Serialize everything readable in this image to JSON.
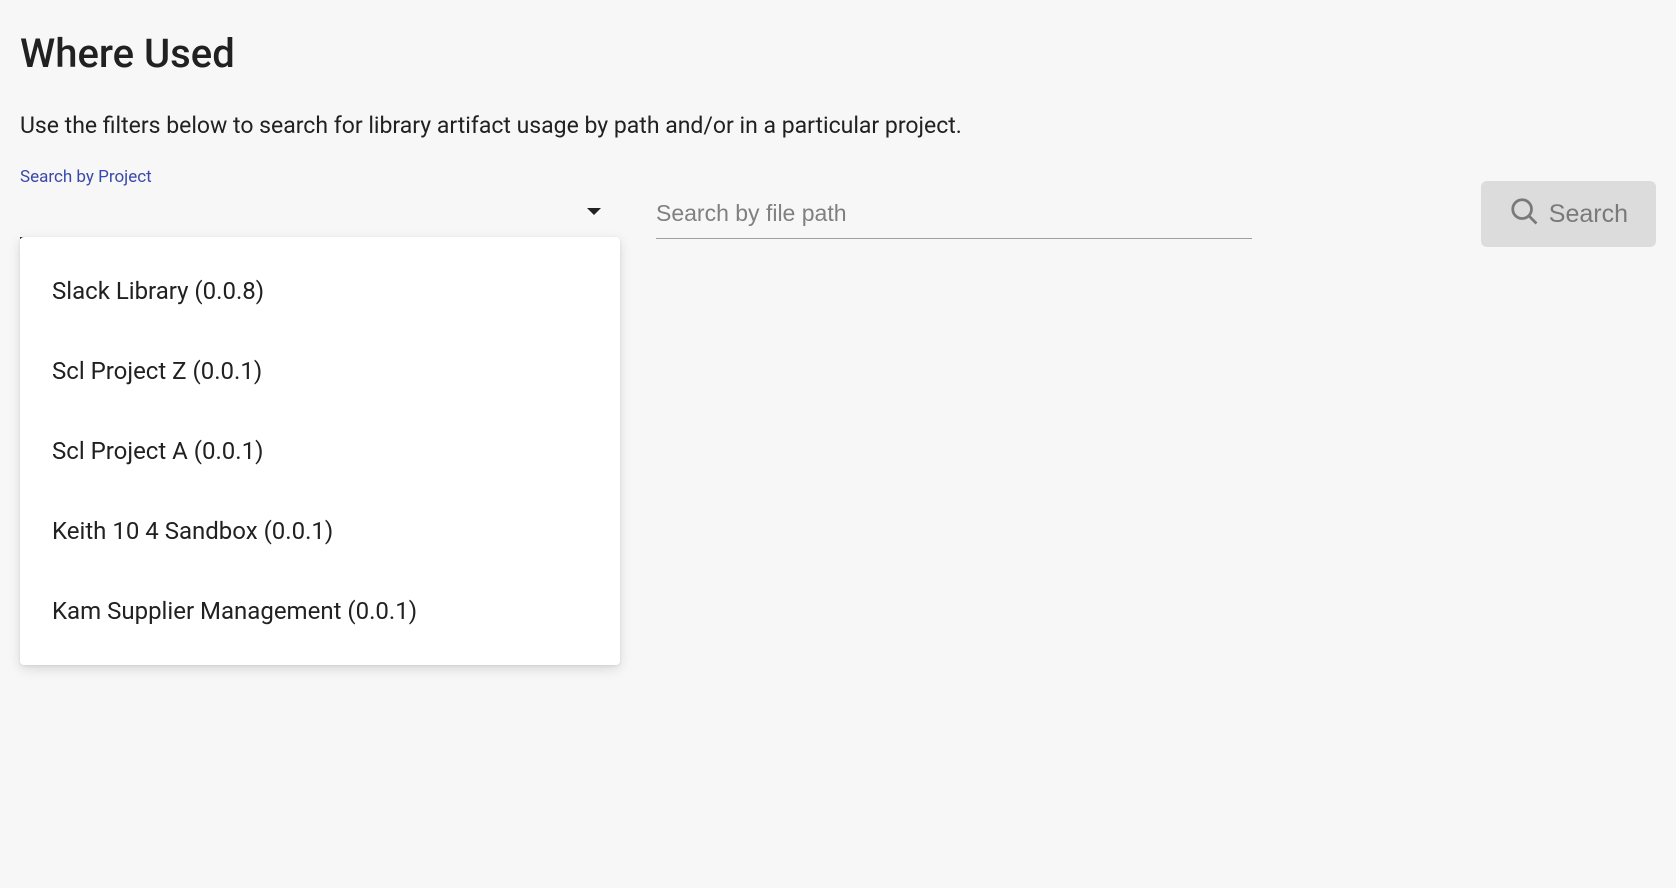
{
  "header": {
    "title": "Where Used",
    "description": "Use the filters below to search for library artifact usage by path and/or in a particular project."
  },
  "filters": {
    "project_label": "Search by Project",
    "project_value": "",
    "filepath_placeholder": "Search by file path",
    "filepath_value": "",
    "search_button_label": "Search"
  },
  "project_dropdown": {
    "options": [
      "Slack Library (0.0.8)",
      "Scl Project Z (0.0.1)",
      "Scl Project A (0.0.1)",
      "Keith 10 4 Sandbox (0.0.1)",
      "Kam Supplier Management (0.0.1)"
    ]
  }
}
